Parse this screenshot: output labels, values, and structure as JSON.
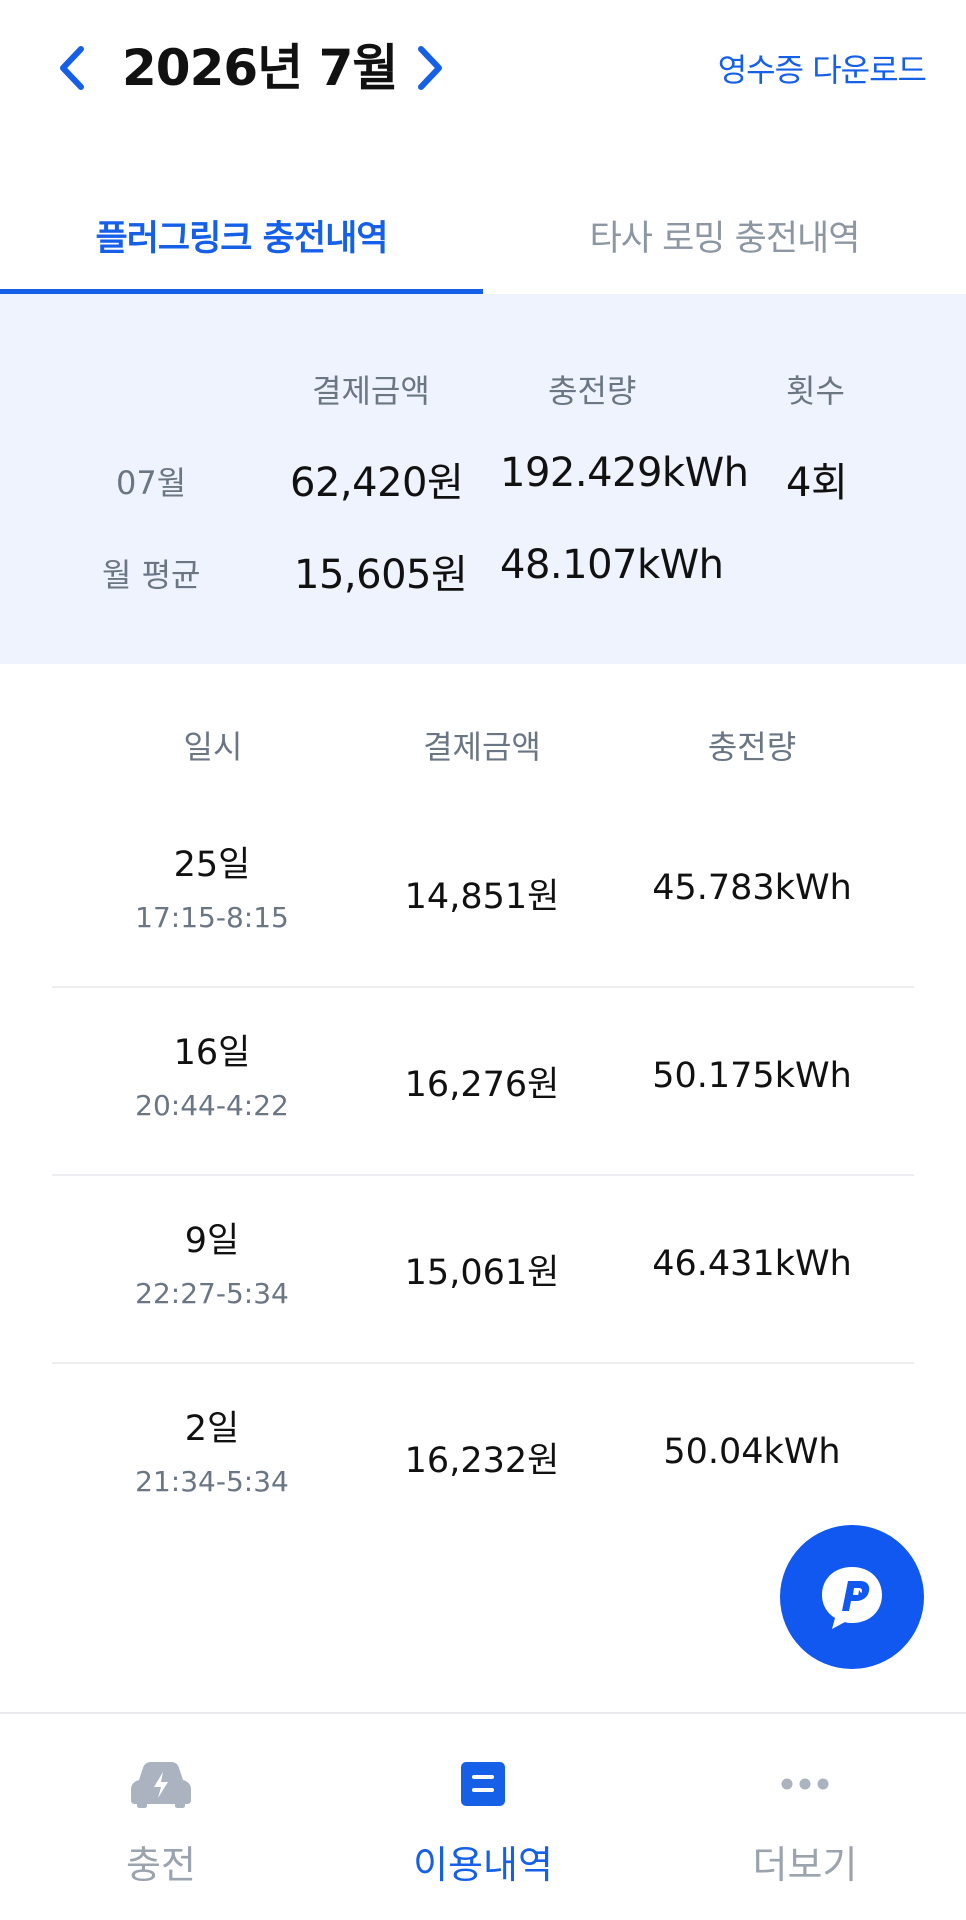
{
  "header": {
    "month_title": "2026년 7월",
    "receipt_label": "영수증 다운로드"
  },
  "tabs": [
    {
      "label": "플러그링크 충전내역",
      "active": true
    },
    {
      "label": "타사 로밍 충전내역",
      "active": false
    }
  ],
  "summary": {
    "columns": [
      "결제금액",
      "충전량",
      "횟수"
    ],
    "month": {
      "label": "07월",
      "amount": "62,420원",
      "energy": "192.429kWh",
      "count": "4회"
    },
    "average": {
      "label": "월 평균",
      "amount": "15,605원",
      "energy": "48.107kWh"
    }
  },
  "history": {
    "columns": [
      "일시",
      "결제금액",
      "충전량"
    ],
    "rows": [
      {
        "day": "25일",
        "time": "17:15-8:15",
        "amount": "14,851원",
        "energy": "45.783kWh"
      },
      {
        "day": "16일",
        "time": "20:44-4:22",
        "amount": "16,276원",
        "energy": "50.175kWh"
      },
      {
        "day": "9일",
        "time": "22:27-5:34",
        "amount": "15,061원",
        "energy": "46.431kWh"
      },
      {
        "day": "2일",
        "time": "21:34-5:34",
        "amount": "16,232원",
        "energy": "50.04kWh"
      }
    ]
  },
  "bottom_nav": [
    {
      "label": "충전",
      "icon": "charging-car-icon",
      "active": false
    },
    {
      "label": "이용내역",
      "icon": "history-list-icon",
      "active": true
    },
    {
      "label": "더보기",
      "icon": "more-dots-icon",
      "active": false
    }
  ],
  "colors": {
    "accent": "#1660e8",
    "summary_bg": "#eef3fd",
    "muted_text": "#6b7684",
    "fab": "#1058f0"
  }
}
